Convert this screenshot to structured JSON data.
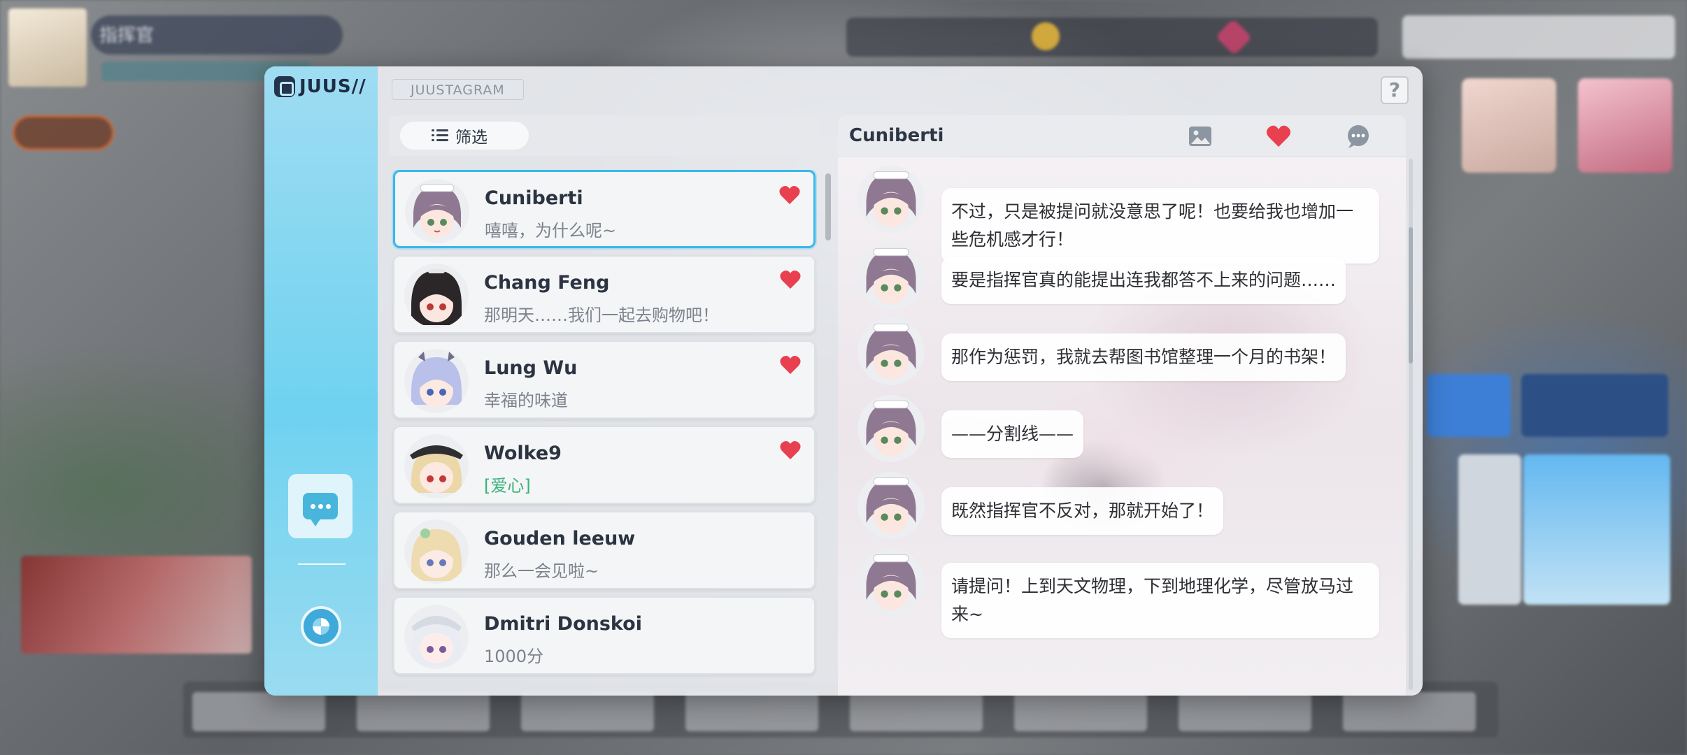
{
  "hud": {
    "player_name": "指挥官"
  },
  "app": {
    "logo_text": "JUUS//",
    "label": "JUUSTAGRAM",
    "help": "?"
  },
  "filter": {
    "label": "筛选"
  },
  "contacts": [
    {
      "name": "Cuniberti",
      "message": "嘻嘻，为什么呢~",
      "liked": true,
      "active": true
    },
    {
      "name": "Chang Feng",
      "message": "那明天……我们一起去购物吧！",
      "liked": true
    },
    {
      "name": "Lung Wu",
      "message": "幸福的味道",
      "liked": true
    },
    {
      "name": "Wolke9",
      "message": "[爱心]",
      "liked": true
    },
    {
      "name": "Gouden leeuw",
      "message": "那么一会见啦~",
      "liked": false
    },
    {
      "name": "Dmitri Donskoi",
      "message": "1000分",
      "liked": false
    }
  ],
  "chat": {
    "title": "Cuniberti",
    "messages": [
      "不过，只是被提问就没意思了呢！也要给我也增加一些危机感才行！",
      "要是指挥官真的能提出连我都答不上来的问题……",
      "那作为惩罚，我就去帮图书馆整理一个月的书架！",
      "——分割线——",
      "既然指挥官不反对，那就开始了！",
      "请提问！上到天文物理，下到地理化学，尽管放马过来~"
    ]
  },
  "icons": {
    "header": [
      "image-icon",
      "heart-icon",
      "comment-icon"
    ],
    "sidebar": [
      "chat-icon",
      "aperture-icon"
    ]
  },
  "colors": {
    "accent": "#38b8ec",
    "heart": "#e8404f",
    "sidebar": "#6fd2f0",
    "liked_text_green": "#3ab27a"
  }
}
